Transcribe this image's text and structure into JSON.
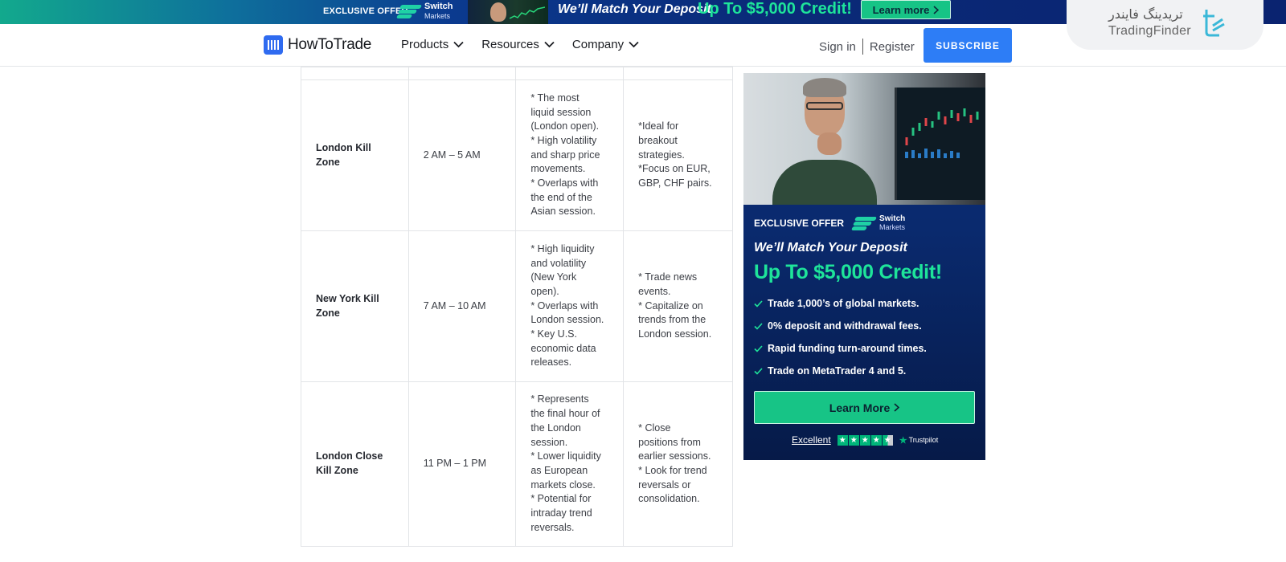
{
  "promo_banner": {
    "exclusive": "EXCLUSIVE OFFER",
    "brand_line1": "Switch",
    "brand_line2": "Markets",
    "headline": "We’ll Match Your Deposit",
    "credit": "Up To $5,000 Credit!",
    "cta": "Learn more",
    "colors": {
      "accent": "#1ee49a",
      "button": "#17c486"
    }
  },
  "watermark": {
    "persian": "تریدینگ فایندر",
    "english": "TradingFinder"
  },
  "nav": {
    "brand": "HowToTrade",
    "menu": [
      {
        "label": "Products"
      },
      {
        "label": "Resources"
      },
      {
        "label": "Company"
      }
    ],
    "sign_in": "Sign in",
    "register": "Register",
    "subscribe": "SUBSCRIBE",
    "colors": {
      "subscribe_bg": "#2d7df6",
      "logo": "#2f6bf0"
    }
  },
  "table": {
    "rows": [
      {
        "name": "London Kill Zone",
        "time": "2 AM – 5 AM",
        "characteristics": [
          "* The most",
          "liquid session",
          "(London open).",
          "* High volatility",
          "and sharp price",
          "movements.",
          "* Overlaps with",
          "the end of the",
          "Asian session."
        ],
        "strategy": [
          "*Ideal for",
          "breakout",
          "strategies.",
          "*Focus on EUR,",
          "GBP, CHF pairs."
        ]
      },
      {
        "name": "New York Kill Zone",
        "time": "7 AM – 10 AM",
        "characteristics": [
          "* High liquidity",
          "and volatility",
          "(New York",
          "open).",
          "* Overlaps with",
          "London session.",
          "* Key U.S.",
          "economic data",
          "releases."
        ],
        "strategy": [
          "* Trade news",
          "events.",
          "* Capitalize on",
          "trends from the",
          "London session."
        ]
      },
      {
        "name": "London Close Kill Zone",
        "time": "11 PM – 1 PM",
        "characteristics": [
          "* Represents",
          "the final hour of",
          "the London",
          "session.",
          "* Lower liquidity",
          "as European",
          "markets close.",
          "* Potential for",
          "intraday trend",
          "reversals."
        ],
        "strategy": [
          "* Close",
          "positions from",
          "earlier sessions.",
          "* Look for trend",
          "reversals or",
          "consolidation."
        ]
      }
    ]
  },
  "side_ad": {
    "exclusive": "EXCLUSIVE OFFER",
    "brand_line1": "Switch",
    "brand_line2": "Markets",
    "headline": "We’ll Match Your Deposit",
    "credit": "Up To $5,000 Credit!",
    "features": [
      "Trade 1,000’s of global markets.",
      "0% deposit and withdrawal fees.",
      "Rapid funding turn-around times.",
      "Trade on MetaTrader 4 and 5."
    ],
    "cta": "Learn More",
    "rating_label": "Excellent",
    "rating_stars": 4.5,
    "trustpilot": "Trustpilot"
  }
}
